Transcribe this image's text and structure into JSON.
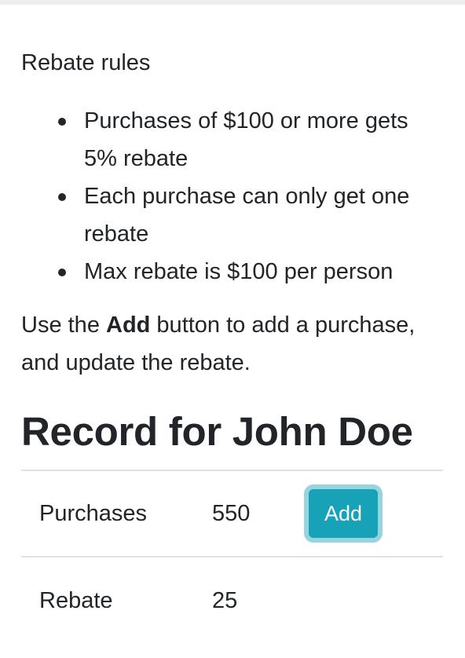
{
  "rules": {
    "title": "Rebate rules",
    "items": [
      "Purchases of $100 or more gets 5% rebate",
      "Each purchase can only get one rebate",
      "Max rebate is $100 per person"
    ]
  },
  "instruction": {
    "prefix": "Use the ",
    "bold": "Add",
    "suffix": " button to add a purchase, and update the rebate."
  },
  "record": {
    "heading": "Record for John Doe",
    "purchases_label": "Purchases",
    "purchases_value": "550",
    "add_label": "Add",
    "rebate_label": "Rebate",
    "rebate_value": "25"
  },
  "colors": {
    "accent": "#17a2b8",
    "text": "#212529",
    "divider": "#dee2e6"
  }
}
